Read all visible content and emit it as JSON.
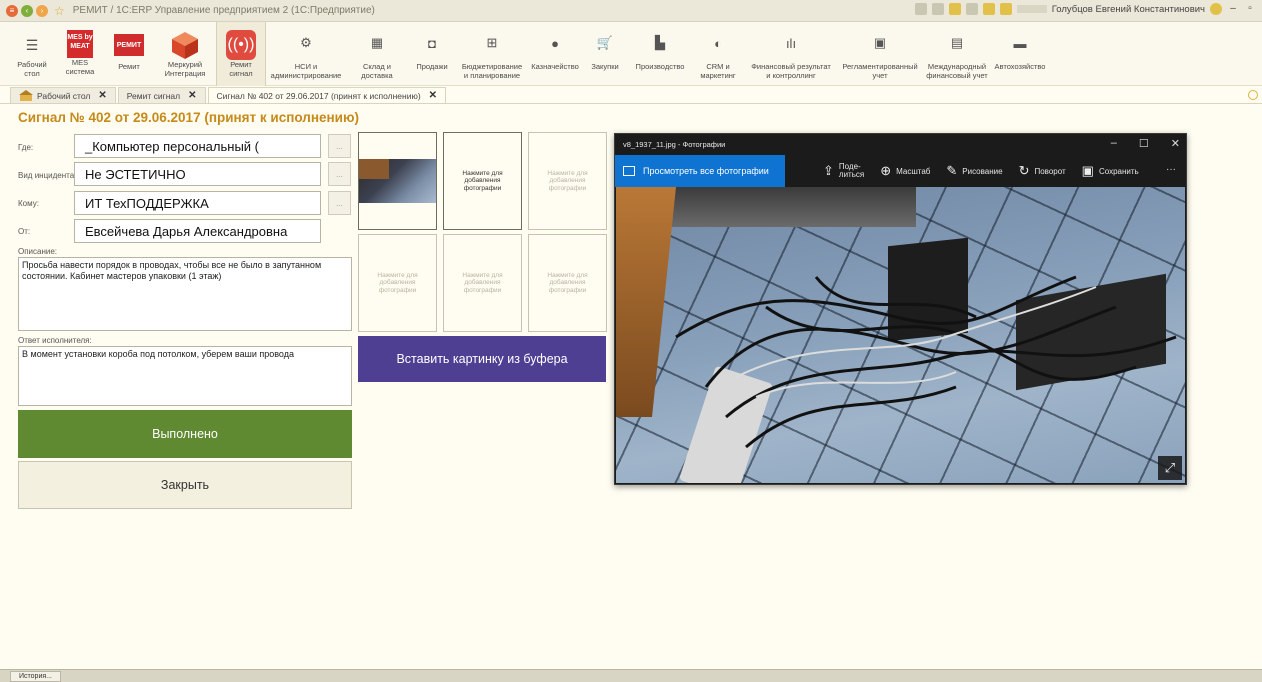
{
  "window": {
    "title": "РЕМИТ / 1С:ERP Управление предприятием 2  (1С:Предприятие)",
    "user": "Голубцов Евгений Константинович"
  },
  "sections": [
    {
      "id": "desktop",
      "label": "Рабочий\nстол",
      "icon": "hamburger-icon"
    },
    {
      "id": "mes",
      "label": "MES\nсистема",
      "icon": "mes-logo",
      "logo_text": "MES by MEAT"
    },
    {
      "id": "remit",
      "label": "Ремит",
      "icon": "remit-logo",
      "logo_text": "РЕМИТ"
    },
    {
      "id": "mercury",
      "label": "Меркурий\nИнтеграция",
      "icon": "cube-logo"
    },
    {
      "id": "signal",
      "label": "Ремит\nсигнал",
      "icon": "alarm-icon",
      "active": true
    },
    {
      "id": "nsi",
      "label": "НСИ и\nадминистрирование",
      "icon": "gear-icon"
    },
    {
      "id": "warehouse",
      "label": "Склад и\nдоставка",
      "icon": "warehouse-icon"
    },
    {
      "id": "sales",
      "label": "Продажи",
      "icon": "bag-icon"
    },
    {
      "id": "budget",
      "label": "Бюджетирование\nи планирование",
      "icon": "budget-icon"
    },
    {
      "id": "treasury",
      "label": "Казначейство",
      "icon": "coin-icon"
    },
    {
      "id": "purchases",
      "label": "Закупки",
      "icon": "cart-icon"
    },
    {
      "id": "production",
      "label": "Производство",
      "icon": "factory-icon"
    },
    {
      "id": "crm",
      "label": "CRM и\nмаркетинг",
      "icon": "crm-icon"
    },
    {
      "id": "finresult",
      "label": "Финансовый результат\nи контроллинг",
      "icon": "chart-icon"
    },
    {
      "id": "regulated",
      "label": "Регламентированный\nучет",
      "icon": "ledger-icon"
    },
    {
      "id": "intl",
      "label": "Международный\nфинансовый учет",
      "icon": "intl-icon"
    },
    {
      "id": "auto",
      "label": "Автохозяйство",
      "icon": "truck-icon"
    }
  ],
  "tabs": [
    {
      "label": "Рабочий стол"
    },
    {
      "label": "Ремит сигнал"
    },
    {
      "label": "Сигнал № 402 от 29.06.2017 (принят к исполнению)",
      "active": true
    }
  ],
  "doc": {
    "title": "Сигнал № 402 от 29.06.2017 (принят к исполнению)",
    "where_label": "Где:",
    "where_value": "_Компьютер персональный (",
    "incident_label": "Вид инцидента:",
    "incident_value": "Не ЭСТЕТИЧНО",
    "to_label": "Кому:",
    "to_value": "ИТ    ТехПОДДЕРЖКА",
    "from_label": "От:",
    "from_value": "Евсейчева Дарья Александровна",
    "desc_label": "Описание:",
    "desc_value": "Просьба навести порядок в проводах, чтобы все не было в запутанном состоянии. Кабинет мастеров упаковки (1 этаж)",
    "reply_label": "Ответ исполнителя:",
    "reply_value": "В момент установки короба под потолком, уберем ваши провода",
    "ellipsis": "...",
    "done_button": "Выполнено",
    "close_button": "Закрыть"
  },
  "photos": {
    "add_text": "Нажмите для добавления фотографии",
    "paste_button": "Вставить картинку из буфера"
  },
  "photo_viewer": {
    "title": "v8_1937_11.jpg - Фотографии",
    "all_photos": "Просмотреть все фотографии",
    "share": "Поде-\nлиться",
    "zoom": "Масштаб",
    "draw": "Рисование",
    "rotate": "Поворот",
    "save": "Сохранить",
    "more": "···"
  },
  "bottom": {
    "history_button": "История..."
  }
}
